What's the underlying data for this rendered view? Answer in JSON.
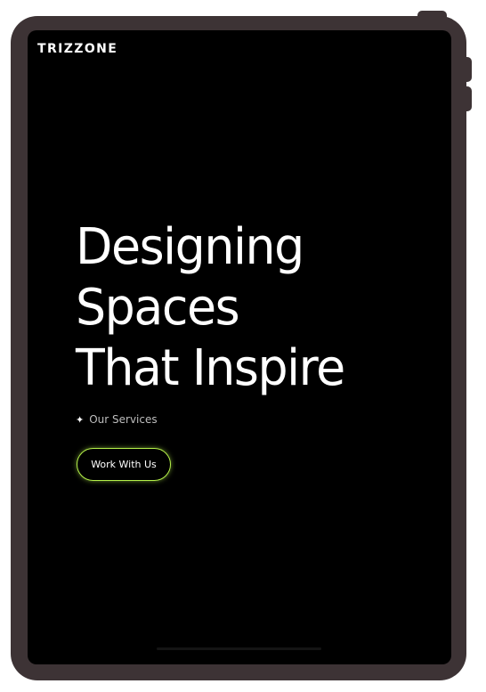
{
  "brand": {
    "logo": "TRIZZONE"
  },
  "hero": {
    "title_lines": [
      "Designing",
      "Spaces",
      "That Inspire"
    ],
    "services_label": "Our Services",
    "cta_label": "Work With Us"
  },
  "colors": {
    "background": "#000000",
    "text": "#ffffff",
    "accent": "#b4f04a",
    "device_frame": "#3d3335"
  },
  "icons": {
    "services": "sparkle-icon"
  }
}
